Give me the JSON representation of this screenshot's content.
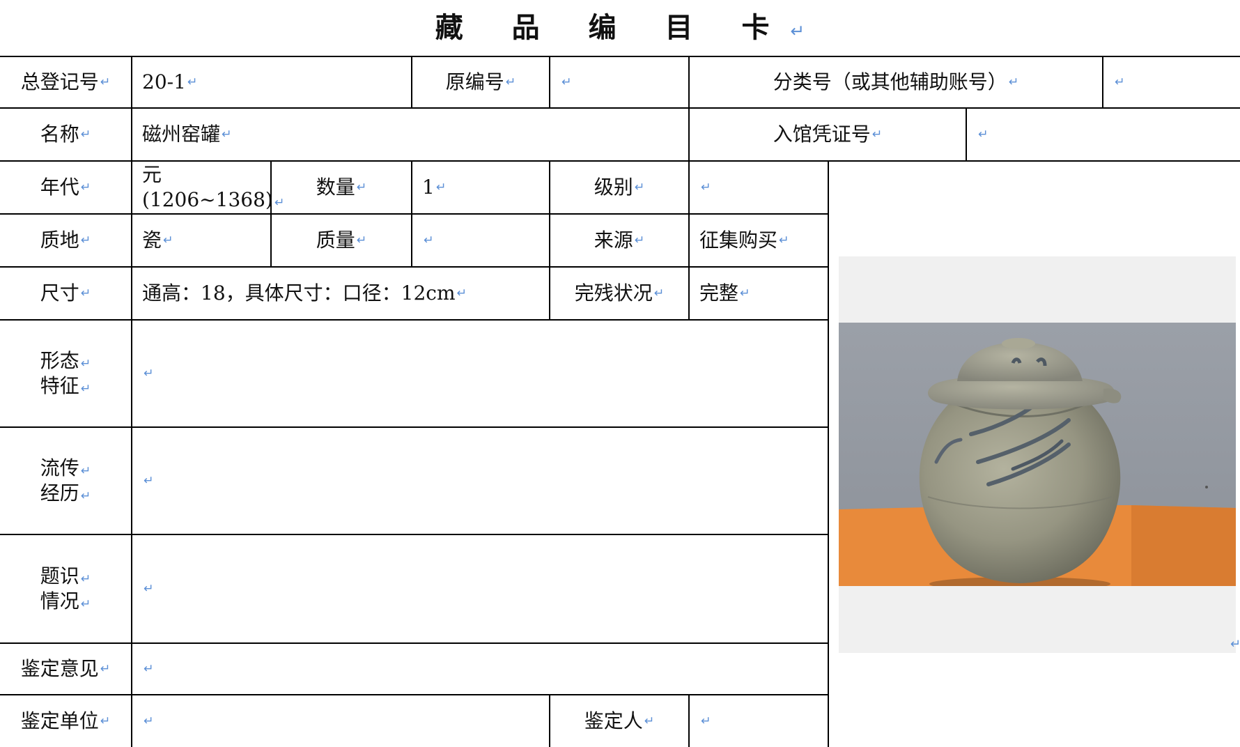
{
  "title": "藏 品 编 目 卡",
  "pilcrow": "↵",
  "row1": {
    "reg_label": "总登记号",
    "reg_value": "20-1",
    "orig_label": "原编号",
    "orig_value": "",
    "class_label": "分类号（或其他辅助账号）",
    "class_value": ""
  },
  "row2": {
    "name_label": "名称",
    "name_value": "磁州窑罐",
    "voucher_label": "入馆凭证号",
    "voucher_value": ""
  },
  "row3": {
    "era_label": "年代",
    "era_value_line1": "元",
    "era_value_line2": "(1206~1368)",
    "qty_label": "数量",
    "qty_value": "1",
    "grade_label": "级别",
    "grade_value": ""
  },
  "row4": {
    "material_label": "质地",
    "material_value": "瓷",
    "weight_label": "质量",
    "weight_value": "",
    "source_label": "来源",
    "source_value": "征集购买"
  },
  "row5": {
    "size_label": "尺寸",
    "size_value": "通高：18，具体尺寸：口径：12cm",
    "condition_label": "完残状况",
    "condition_value": "完整"
  },
  "row6": {
    "label_line1": "形态",
    "label_line2": "特征",
    "value": ""
  },
  "row7": {
    "label_line1": "流传",
    "label_line2": "经历",
    "value": ""
  },
  "row8": {
    "label_line1": "题识",
    "label_line2": "情况",
    "value": ""
  },
  "row9": {
    "label": "鉴定意见",
    "value": ""
  },
  "row10": {
    "unit_label": "鉴定单位",
    "unit_value": "",
    "person_label": "鉴定人",
    "person_value": ""
  },
  "photo": {
    "subject": "ceramic-jar-photo"
  },
  "colors": {
    "paragraph_mark": "#5b8fd6",
    "grid": "#000000",
    "photo_bg": "#f0f0f0"
  }
}
